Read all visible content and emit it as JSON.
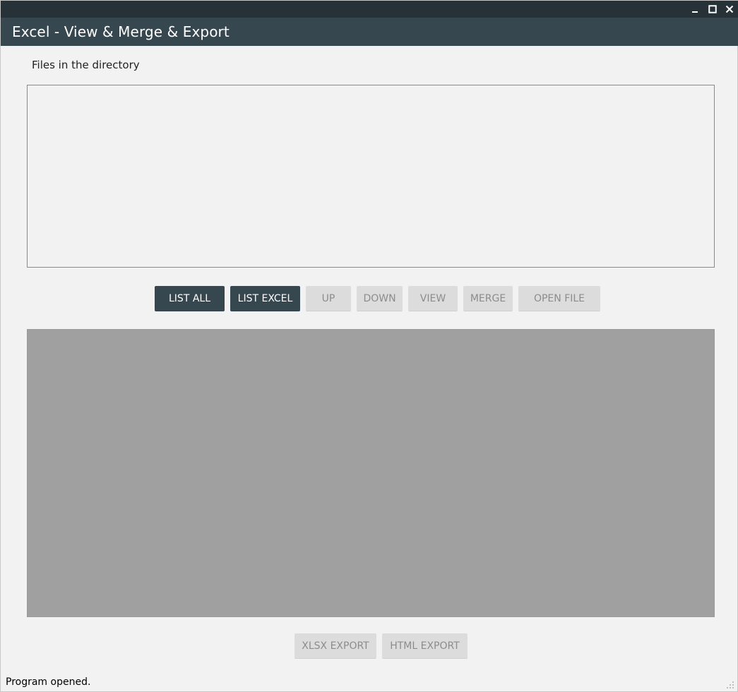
{
  "window": {
    "title": "Excel - View & Merge & Export",
    "controls": [
      "minimize-icon",
      "maximize-icon",
      "close-icon"
    ]
  },
  "files": {
    "label": "Files in the directory",
    "items": []
  },
  "toolbar": {
    "list_all": "LIST ALL",
    "list_excel": "LIST EXCEL",
    "up": "UP",
    "down": "DOWN",
    "view": "VIEW",
    "merge": "MERGE",
    "open_file": "OPEN FILE"
  },
  "export": {
    "xlsx": "XLSX EXPORT",
    "html": "HTML EXPORT"
  },
  "status": {
    "text": "Program opened."
  },
  "colors": {
    "topbar": "#263238",
    "titlebar": "#37474f",
    "primary_button": "#37474f",
    "disabled_button": "#dcdcdc",
    "preview_area": "#a0a0a0"
  }
}
